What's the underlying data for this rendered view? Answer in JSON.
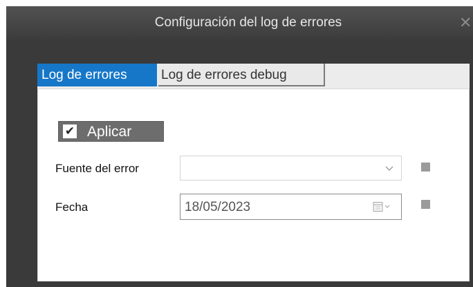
{
  "dialog": {
    "title": "Configuración del log de errores",
    "close_glyph": "✕"
  },
  "tabs": [
    {
      "label": "Log de errores",
      "active": true
    },
    {
      "label": "Log de errores debug",
      "active": false
    }
  ],
  "apply": {
    "label": "Aplicar",
    "checked": true,
    "check_glyph": "✔"
  },
  "fields": {
    "error_source": {
      "label": "Fuente del error",
      "value": ""
    },
    "date": {
      "label": "Fecha",
      "value": "18/05/2023"
    }
  },
  "colors": {
    "accent": "#1677c8",
    "window_bg": "#3a3a3a",
    "button_bg": "#6d6d6d"
  },
  "icons": [
    "close-icon",
    "check-icon",
    "chevron-down-icon",
    "calendar-icon"
  ]
}
